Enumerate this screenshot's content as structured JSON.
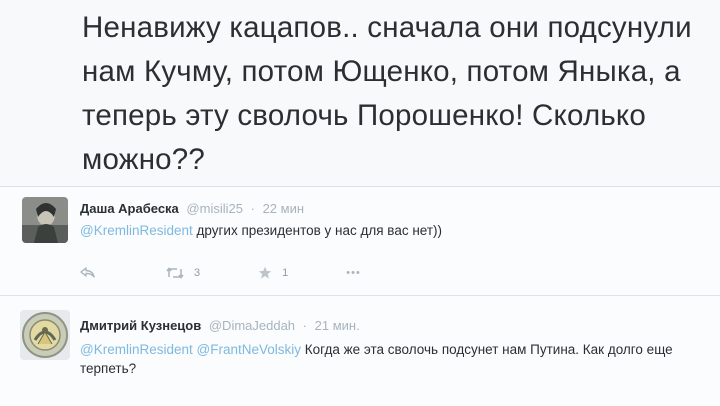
{
  "main_tweet": {
    "text": "Ненавижу кацапов.. сначала они подсунули нам Кучму, потом Ющенко, потом Яныка, а теперь эту сволочь Порошенко! Сколько можно??"
  },
  "replies": [
    {
      "name": "Даша Арабеска",
      "handle": "@misili25",
      "dot": "·",
      "time": "22 мин",
      "mention": "@KremlinResident",
      "text": "других президентов у нас для вас нет))",
      "retweet_count": "3",
      "favorite_count": "1",
      "more_label": "•••"
    },
    {
      "name": "Дмитрий Кузнецов",
      "handle": "@DimaJeddah",
      "dot": "·",
      "time": "21 мин.",
      "mention1": "@KremlinResident",
      "mention2": "@FrantNeVolskiy",
      "text": "Когда же эта сволочь подсунет нам Путина. Как долго еще терпеть?"
    }
  ],
  "colors": {
    "mention": "#7db9e0",
    "meta": "#a8b3bd",
    "text": "#292f33"
  }
}
